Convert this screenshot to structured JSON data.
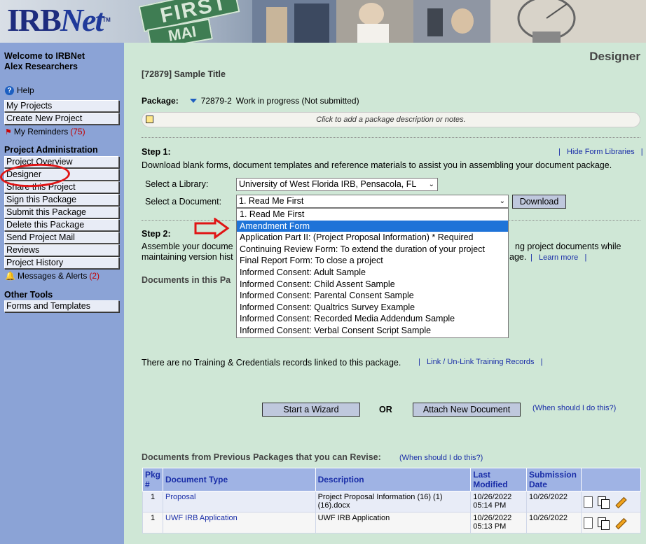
{
  "header": {
    "logo_main": "IRB",
    "logo_net": "Net",
    "logo_tm": "TM",
    "sign_text": "FIRST S",
    "sign2_text": "MAI"
  },
  "sidebar": {
    "welcome_line1": "Welcome to IRBNet",
    "welcome_line2": "Alex Researchers",
    "help": "Help",
    "my_projects": "My Projects",
    "create_new_project": "Create New Project",
    "my_reminders": "My Reminders",
    "reminders_count": "(75)",
    "project_admin_head": "Project Administration",
    "admin_items": [
      "Project Overview",
      "Designer",
      "Share this Project",
      "Sign this Package",
      "Submit this Package",
      "Delete this Package",
      "Send Project Mail",
      "Reviews",
      "Project History"
    ],
    "messages": "Messages & Alerts",
    "messages_count": "(2)",
    "other_tools_head": "Other Tools",
    "forms_templates": "Forms and Templates"
  },
  "main": {
    "page_title": "Designer",
    "project_title": "[72879] Sample Title",
    "package_label": "Package:",
    "package_id": "72879-2",
    "package_status": "Work in progress (Not submitted)",
    "notes_prompt": "Click to add a package description or notes.",
    "step1_head": "Step 1:",
    "hide_libraries": "Hide Form Libraries",
    "step1_text": "Download blank forms, document templates and reference materials to assist you in assembling your document package.",
    "library_label": "Select a Library:",
    "library_value": "University of West Florida IRB, Pensacola, FL",
    "document_label": "Select a Document:",
    "document_value": "1. Read Me First",
    "download_button": "Download",
    "document_options": [
      "1. Read Me First",
      "Amendment Form",
      "Application Part II: (Project Proposal Information) * Required",
      "Continuing Review Form: To extend the duration of your project",
      "Final Report Form: To close a project",
      "Informed Consent: Adult Sample",
      "Informed Consent: Child Assent Sample",
      "Informed Consent: Parental Consent Sample",
      "Informed Consent: Qualtrics Survey Example",
      "Informed Consent: Recorded Media Addendum Sample",
      "Informed Consent: Verbal Consent Script Sample"
    ],
    "selected_option_index": 1,
    "step2_head": "Step 2:",
    "step2_line1_left": "Assemble your docume",
    "step2_line1_right": "ng project documents while",
    "step2_line2_left": "maintaining version hist",
    "step2_line2_right": "age.",
    "learn_more": "Learn more",
    "documents_in_package": "Documents in this Pa",
    "training_text": "There are no Training & Credentials records linked to this package.",
    "link_training": "Link / Un-Link Training Records",
    "start_wizard": "Start a Wizard",
    "or": "OR",
    "attach_new": "Attach New Document",
    "when_should": "(When should I do this?)",
    "prev_packages_title": "Documents from Previous Packages that you can Revise:",
    "prev_when_should": "(When should I do this?)",
    "table": {
      "headers": [
        "Pkg #",
        "Document Type",
        "Description",
        "Last Modified",
        "Submission Date"
      ],
      "rows": [
        {
          "pkg": "1",
          "type": "Proposal",
          "desc": "Project Proposal Information (16) (1) (16).docx",
          "modified": "10/26/2022 05:14 PM",
          "submitted": "10/26/2022"
        },
        {
          "pkg": "1",
          "type": "UWF IRB Application",
          "desc": "UWF IRB Application",
          "modified": "10/26/2022 05:13 PM",
          "submitted": "10/26/2022"
        }
      ]
    }
  },
  "colors": {
    "sidebar_bg": "#8ba3d6",
    "main_bg": "#cfe7d6",
    "link": "#1a2ea8",
    "highlight": "#1e73d8",
    "annotation_red": "#e01515"
  }
}
